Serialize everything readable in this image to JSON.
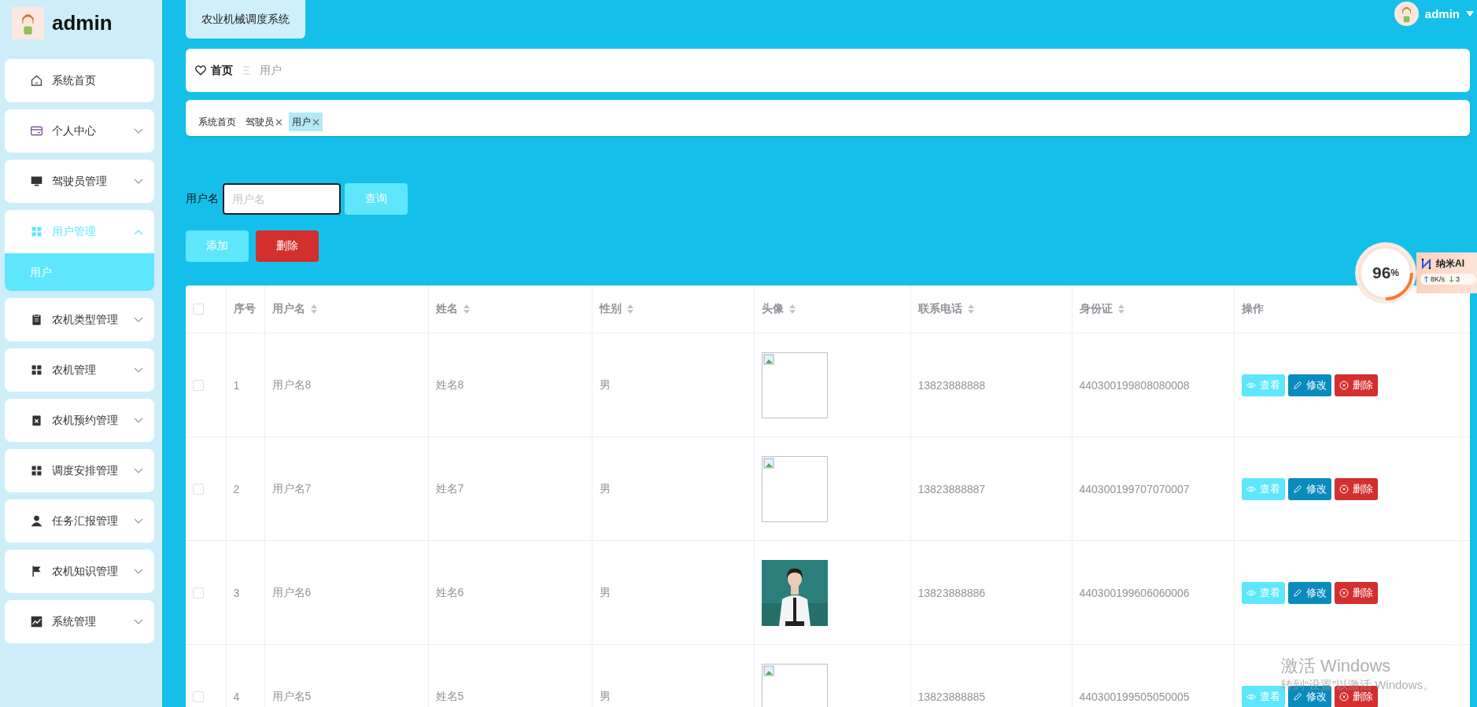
{
  "sidebar": {
    "user": "admin",
    "items": [
      {
        "label": "系统首页"
      },
      {
        "label": "个人中心",
        "expanded": false
      },
      {
        "label": "驾驶员管理",
        "expanded": false
      },
      {
        "label": "用户管理",
        "expanded": true,
        "children": [
          {
            "label": "用户",
            "selected": true
          }
        ]
      },
      {
        "label": "农机类型管理",
        "expanded": false
      },
      {
        "label": "农机管理",
        "expanded": false
      },
      {
        "label": "农机预约管理",
        "expanded": false
      },
      {
        "label": "调度安排管理",
        "expanded": false
      },
      {
        "label": "任务汇报管理",
        "expanded": false
      },
      {
        "label": "农机知识管理",
        "expanded": false
      },
      {
        "label": "系统管理",
        "expanded": false
      }
    ]
  },
  "header": {
    "title": "农业机械调度系统",
    "user": "admin"
  },
  "breadcrumb": {
    "home": "首页",
    "current": "用户"
  },
  "tags": [
    {
      "label": "系统首页",
      "closable": false,
      "selected": false
    },
    {
      "label": "驾驶员",
      "closable": true,
      "selected": false
    },
    {
      "label": "用户",
      "closable": true,
      "selected": true
    }
  ],
  "search": {
    "label": "用户名",
    "placeholder": "用户名",
    "button": "查询"
  },
  "actions": [
    {
      "label": "添加",
      "kind": "add"
    },
    {
      "label": "删除",
      "kind": "delete"
    }
  ],
  "table": {
    "select_all": {
      "checked": false
    },
    "columns": [
      {
        "label": "序号",
        "sortable": false
      },
      {
        "label": "用户名",
        "sortable": true
      },
      {
        "label": "姓名",
        "sortable": true
      },
      {
        "label": "性别",
        "sortable": true
      },
      {
        "label": "头像",
        "sortable": true
      },
      {
        "label": "联系电话",
        "sortable": true
      },
      {
        "label": "身份证",
        "sortable": true
      },
      {
        "label": "操作",
        "sortable": false
      }
    ],
    "rows": [
      {
        "checked": false,
        "index": "1",
        "username": "用户名8",
        "name": "姓名8",
        "gender": "男",
        "avatar": {
          "kind": "broken"
        },
        "phone": "13823888888",
        "id_card": "440300199808080008",
        "buttons": [
          {
            "label": "查看",
            "kind": "view"
          },
          {
            "label": "修改",
            "kind": "edit"
          },
          {
            "label": "删除",
            "kind": "delete"
          }
        ]
      },
      {
        "checked": false,
        "index": "2",
        "username": "用户名7",
        "name": "姓名7",
        "gender": "男",
        "avatar": {
          "kind": "broken"
        },
        "phone": "13823888887",
        "id_card": "440300199707070007",
        "buttons": [
          {
            "label": "查看",
            "kind": "view"
          },
          {
            "label": "修改",
            "kind": "edit"
          },
          {
            "label": "删除",
            "kind": "delete"
          }
        ]
      },
      {
        "checked": false,
        "index": "3",
        "username": "用户名6",
        "name": "姓名6",
        "gender": "男",
        "avatar": {
          "kind": "picture"
        },
        "phone": "13823888886",
        "id_card": "440300199606060006",
        "buttons": [
          {
            "label": "查看",
            "kind": "view"
          },
          {
            "label": "修改",
            "kind": "edit"
          },
          {
            "label": "删除",
            "kind": "delete"
          }
        ]
      },
      {
        "checked": false,
        "index": "4",
        "username": "用户名5",
        "name": "姓名5",
        "gender": "男",
        "avatar": {
          "kind": "broken"
        },
        "phone": "13823888885",
        "id_card": "440300199505050005",
        "buttons": [
          {
            "label": "查看",
            "kind": "view"
          },
          {
            "label": "修改",
            "kind": "edit"
          },
          {
            "label": "删除",
            "kind": "delete"
          }
        ]
      }
    ]
  },
  "widget": {
    "percent": "96",
    "unit": "%",
    "name": "纳米AI",
    "upload": "8K/s",
    "download": "3"
  },
  "os_notice": {
    "title": "激活 Windows",
    "text": "转到“设置”以激活 Windows。"
  }
}
